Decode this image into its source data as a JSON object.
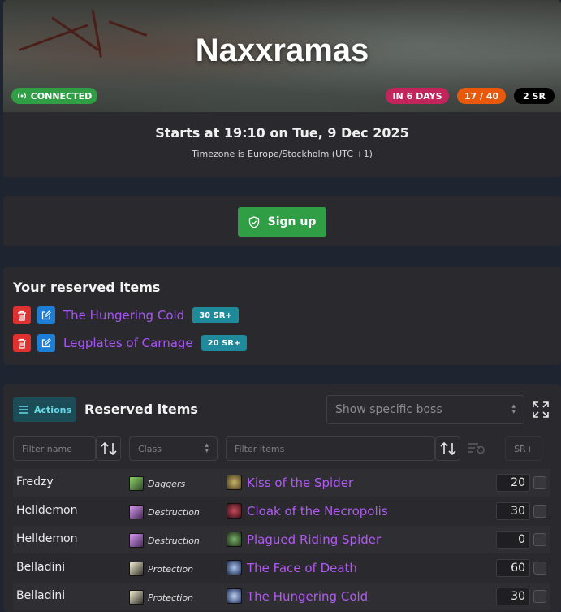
{
  "hero": {
    "title": "Naxxramas",
    "connected_label": "CONNECTED",
    "days_label": "IN 6 DAYS",
    "slots_label": "17 / 40",
    "sr_label": "2 SR",
    "starts": "Starts at 19:10 on Tue, 9 Dec 2025",
    "timezone": "Timezone is Europe/Stockholm (UTC +1)",
    "colors": {
      "connected": "#2f9e44",
      "days": "#c2255c",
      "slots": "#e8590c",
      "sr": "#000000"
    }
  },
  "signup": {
    "label": "Sign up",
    "icon": "shield-check-icon",
    "color": "#2f9e44"
  },
  "your_reserved": {
    "title": "Your reserved items",
    "items": [
      {
        "name": "The Hungering Cold",
        "badge": "30 SR+"
      },
      {
        "name": "Legplates of Carnage",
        "badge": "20 SR+"
      }
    ]
  },
  "reserved": {
    "actions_label": "Actions",
    "title": "Reserved items",
    "boss_placeholder": "Show specific boss",
    "filters": {
      "name_placeholder": "Filter name",
      "class_label": "Class",
      "items_placeholder": "Filter items",
      "sr_label": "SR+"
    },
    "rows": [
      {
        "name": "Fredzy",
        "spec": "Daggers",
        "spec_color": "#8fd16b",
        "item": "Kiss of the Spider",
        "item_color": "#8a7a3a",
        "sr": "20"
      },
      {
        "name": "Helldemon",
        "spec": "Destruction",
        "spec_color": "#b56bd6",
        "item": "Cloak of the Necropolis",
        "item_color": "#8a2f3c",
        "sr": "30"
      },
      {
        "name": "Helldemon",
        "spec": "Destruction",
        "spec_color": "#b56bd6",
        "item": "Plagued Riding Spider",
        "item_color": "#4f7a3a",
        "sr": "0"
      },
      {
        "name": "Belladini",
        "spec": "Protection",
        "spec_color": "#d9d5a8",
        "item": "The Face of Death",
        "item_color": "#6f8fd6",
        "sr": "60"
      },
      {
        "name": "Belladini",
        "spec": "Protection",
        "spec_color": "#d9d5a8",
        "item": "The Hungering Cold",
        "item_color": "#7aa0d8",
        "sr": "30"
      }
    ]
  }
}
